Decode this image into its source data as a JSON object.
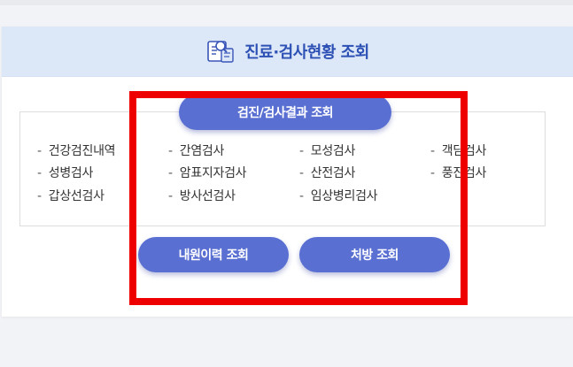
{
  "header": {
    "title": "진료·검사현황 조회",
    "icon": "document-search-icon"
  },
  "results_button": {
    "label": "검진/검사결과 조회"
  },
  "exam_items": [
    "건강검진내역",
    "간염검사",
    "모성검사",
    "객담검사",
    "성병검사",
    "암표지자검사",
    "산전검사",
    "풍진검사",
    "갑상선검사",
    "방사선검사",
    "임상병리검사"
  ],
  "history_button": {
    "label": "내원이력 조회"
  },
  "prescription_button": {
    "label": "처방 조회"
  },
  "colors": {
    "accent": "#5a6fd2",
    "header_bg": "#dce8f8",
    "title": "#2d50b5",
    "highlight": "#ee0000"
  }
}
